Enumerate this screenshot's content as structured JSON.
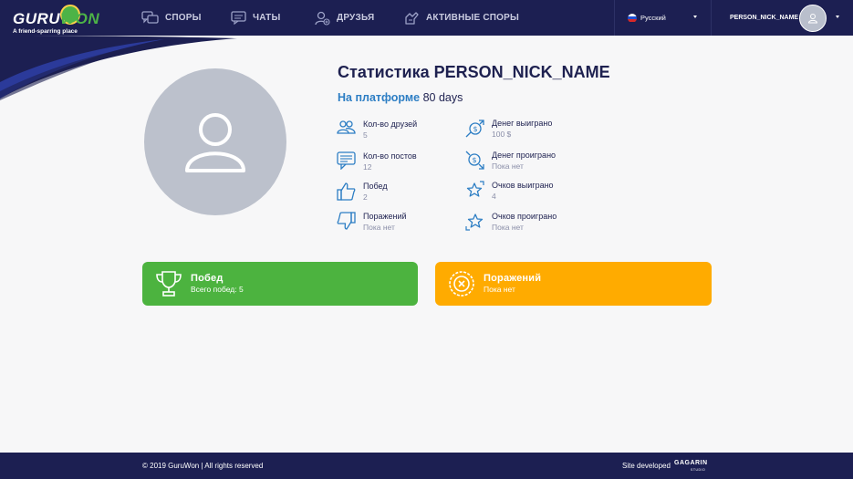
{
  "header": {
    "logo": {
      "part1": "GURU",
      "part2": "WON",
      "tagline": "A friend-sparring place"
    },
    "nav": [
      {
        "label": "СПОРЫ",
        "icon": "chat-bubbles-icon"
      },
      {
        "label": "ЧАТЫ",
        "icon": "message-icon"
      },
      {
        "label": "ДРУЗЬЯ",
        "icon": "add-friend-icon"
      },
      {
        "label": "АКТИВНЫЕ СПОРЫ",
        "icon": "handshake-icon"
      }
    ],
    "language": "Русский",
    "user_name": "PERSON_NICK_NAME"
  },
  "profile": {
    "title": "Статистика PERSON_NICK_NAME",
    "platform_label": "На платформе",
    "platform_value": "80 days"
  },
  "stats": {
    "friends": {
      "label": "Кол-во друзей",
      "value": "5"
    },
    "posts": {
      "label": "Кол-во постов",
      "value": "12"
    },
    "wins": {
      "label": "Побед",
      "value": "2"
    },
    "losses": {
      "label": "Поражений",
      "value": "Пока нет"
    },
    "money_won": {
      "label": "Денег выиграно",
      "value": "100 $"
    },
    "money_lost": {
      "label": "Денег проиграно",
      "value": "Пока нет"
    },
    "points_won": {
      "label": "Очков выиграно",
      "value": "4"
    },
    "points_lost": {
      "label": "Очков проиграно",
      "value": "Пока нет"
    }
  },
  "cards": {
    "wins": {
      "title": "Побед",
      "subtitle": "Всего побед: 5"
    },
    "losses": {
      "title": "Поражений",
      "subtitle": "Пока нет"
    }
  },
  "footer": {
    "copyright": "© 2019 GuruWon  |  All rights reserved",
    "developed": "Site developed",
    "studio": "GAGARIN",
    "studio_sub": "STUDIO"
  },
  "colors": {
    "navy": "#1c1f52",
    "accent_blue": "#2d7ec4",
    "win_green": "#4cb33f",
    "lose_orange": "#ffab00"
  }
}
